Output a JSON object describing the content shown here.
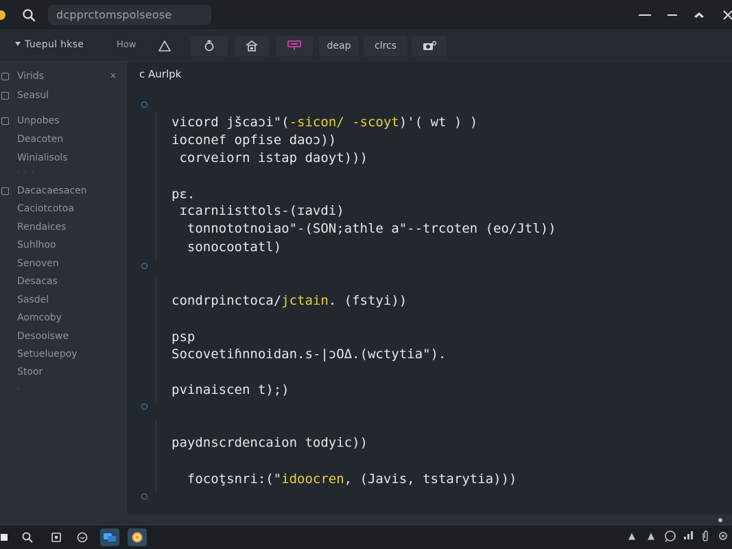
{
  "titlebar": {
    "search_text": "dcpprctomspolseose",
    "minimize_glyph": "—",
    "restore_glyph": "—",
    "back_glyph": "◆",
    "close_glyph": "✕"
  },
  "toolbar": {
    "title": "Tuepul hkse",
    "how_label": "How",
    "deap_label": "deap",
    "clrcs_label": "clrcs"
  },
  "sidebar": {
    "close_glyph": "×",
    "items": [
      {
        "label": "Virids",
        "checkbox": true
      },
      {
        "label": "Seasul",
        "checkbox": true
      },
      {
        "label": "Unpobes",
        "checkbox": true
      },
      {
        "label": "Deacoten",
        "checkbox": false
      },
      {
        "label": "Winialisols",
        "checkbox": false
      },
      {
        "label": "Dacacaesacen",
        "checkbox": true
      },
      {
        "label": "Caciotcotoa",
        "checkbox": false
      },
      {
        "label": "Rendaices",
        "checkbox": false
      },
      {
        "label": "Suhlhoo",
        "checkbox": false
      },
      {
        "label": "Senoven",
        "checkbox": false
      },
      {
        "label": "Desacas",
        "checkbox": false
      },
      {
        "label": "Sasdel",
        "checkbox": false
      },
      {
        "label": "Aomcoby",
        "checkbox": false
      },
      {
        "label": "Desooiswe",
        "checkbox": false
      },
      {
        "label": "Setueluepoy",
        "checkbox": false
      },
      {
        "label": "Stoor",
        "checkbox": false
      }
    ],
    "separator_dots": "· · ·",
    "trailing_dot": "·"
  },
  "editor": {
    "tab_label": "c Aurlpk",
    "lines": [
      {
        "pre": "vicord jšcaɔi\"(",
        "hl": "-sicon/ -scoyt",
        "post": ")'( wt ) )"
      },
      {
        "pre": "ioconef opfise daoɔ))",
        "hl": "",
        "post": ""
      },
      {
        "pre": " corveiorn istap daoyt)))",
        "hl": "",
        "post": ""
      },
      {
        "pre": "pε.",
        "hl": "",
        "post": ""
      },
      {
        "pre": " ɪcarniisttols-(ɪavdi)",
        "hl": "",
        "post": ""
      },
      {
        "pre": "  tonnototnoiao\"-(SON;athle a\"--trcoten (eo/Jtl))",
        "hl": "",
        "post": ""
      },
      {
        "pre": "  sonocootatl)",
        "hl": "",
        "post": ""
      },
      {
        "pre": "condrpinctoca/",
        "hl": "jctain",
        "post": ". (fstyi))"
      },
      {
        "pre": "psp",
        "hl": "",
        "post": ""
      },
      {
        "pre": "Socovetiɦnnoidan.s-|ɔOΔ.(wctytia\").",
        "hl": "",
        "post": ""
      },
      {
        "pre": "pvinaiscen t);)",
        "hl": "",
        "post": ""
      },
      {
        "pre": "paydnscrdencaion todyic))",
        "hl": "",
        "post": ""
      },
      {
        "pre": "  focoţsnri:(\"",
        "hl": "idoocren",
        "post": ", (Javis, tstarytia)))"
      }
    ]
  },
  "tray": {
    "glyph_1": "▲",
    "glyph_2": "▲"
  }
}
